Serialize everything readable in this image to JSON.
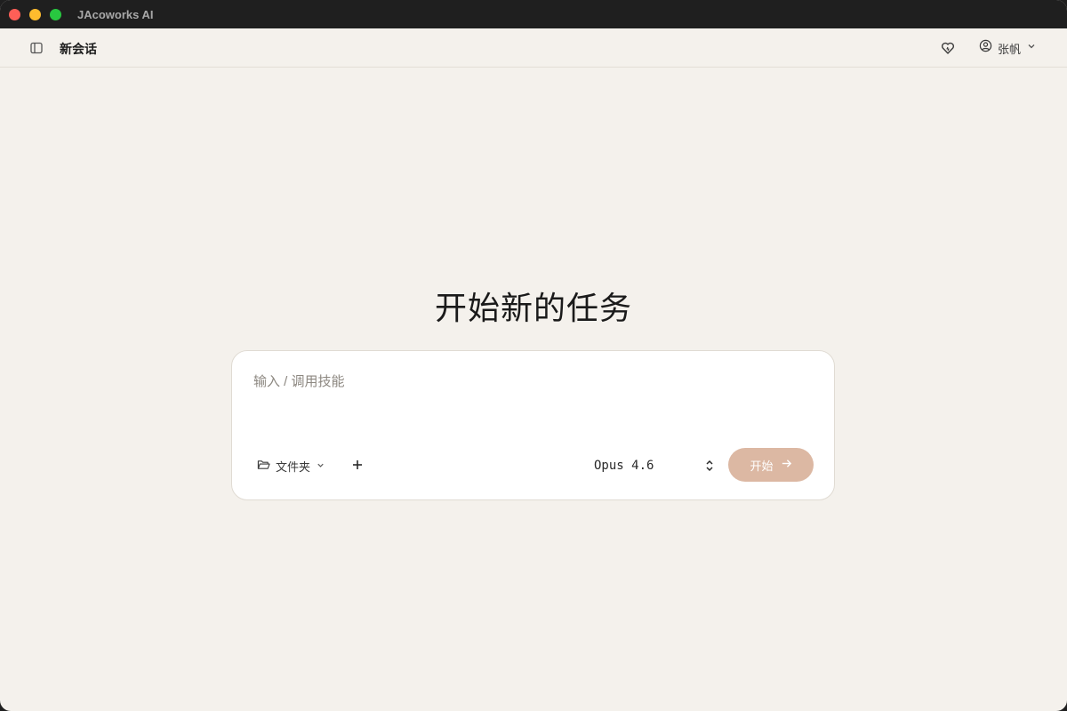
{
  "window": {
    "app_title": "JAcoworks AI"
  },
  "header": {
    "session_title": "新会话",
    "user_name": "张帆"
  },
  "main": {
    "hero_title": "开始新的任务",
    "composer": {
      "input_value": "",
      "input_placeholder": "输入 / 调用技能",
      "folder_label": "文件夹",
      "model_selected": "Opus 4.6",
      "start_label": "开始"
    }
  },
  "icons": {
    "sidebar_toggle": "sidebar-toggle-icon",
    "heart": "heart-icon",
    "user": "user-circle-icon",
    "chevron": "chevron-down-icon",
    "folder": "folder-open-icon",
    "plus": "plus-icon",
    "updown": "chevron-up-down-icon",
    "arrow": "arrow-right-icon"
  },
  "colors": {
    "background": "#f4f1ec",
    "titlebar": "#1f1f1f",
    "accent": "#dcb8a3",
    "card": "#ffffff"
  }
}
